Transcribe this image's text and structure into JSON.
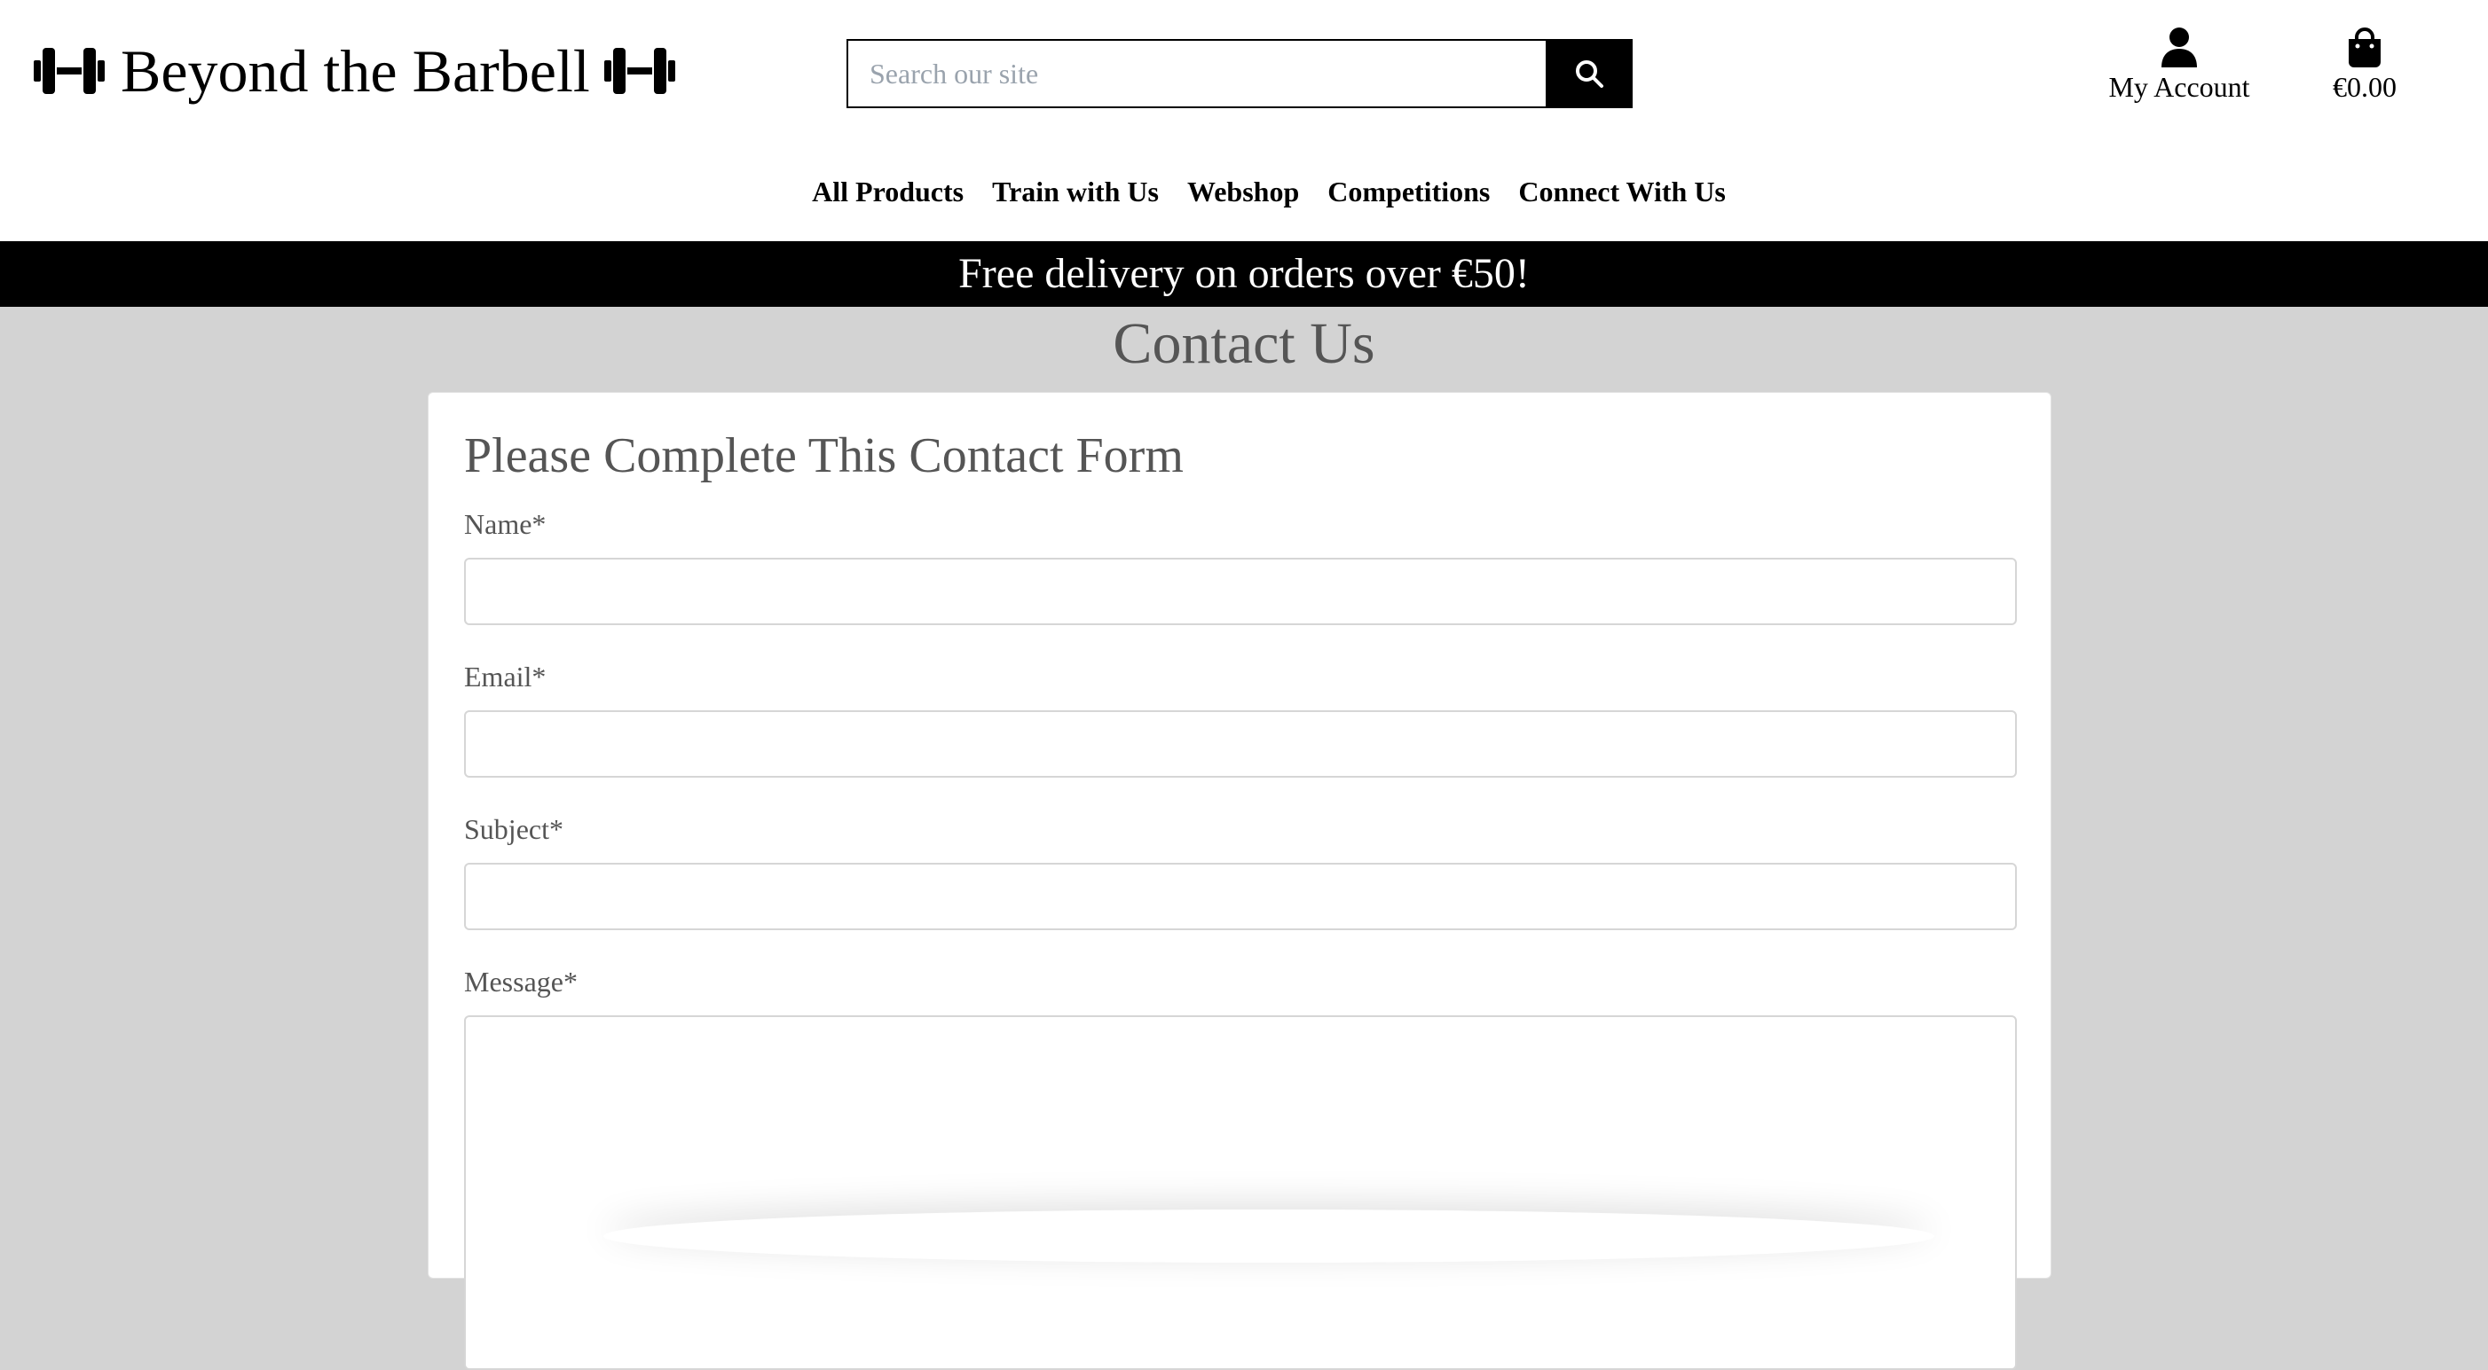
{
  "header": {
    "logo_text": "Beyond the Barbell",
    "search": {
      "placeholder": "Search our site",
      "value": ""
    },
    "account_label": "My Account",
    "cart_total": "€0.00"
  },
  "nav": {
    "items": [
      {
        "label": "All Products"
      },
      {
        "label": "Train with Us"
      },
      {
        "label": "Webshop"
      },
      {
        "label": "Competitions"
      },
      {
        "label": "Connect With Us"
      }
    ]
  },
  "banner": {
    "text": "Free delivery on orders over €50!"
  },
  "main": {
    "title": "Contact Us",
    "form": {
      "heading": "Please Complete This Contact Form",
      "fields": [
        {
          "label": "Name*",
          "value": ""
        },
        {
          "label": "Email*",
          "value": ""
        },
        {
          "label": "Subject*",
          "value": ""
        },
        {
          "label": "Message*",
          "value": ""
        }
      ]
    }
  },
  "colors": {
    "page_background": "#d3d3d3",
    "banner_background": "#000000",
    "banner_text": "#ffffff",
    "heading_text": "#555555",
    "input_border": "#d6d6d6"
  },
  "icons": {
    "logo": "dumbbell-icon",
    "search": "search-icon",
    "account": "user-icon",
    "cart": "shopping-bag-icon"
  }
}
